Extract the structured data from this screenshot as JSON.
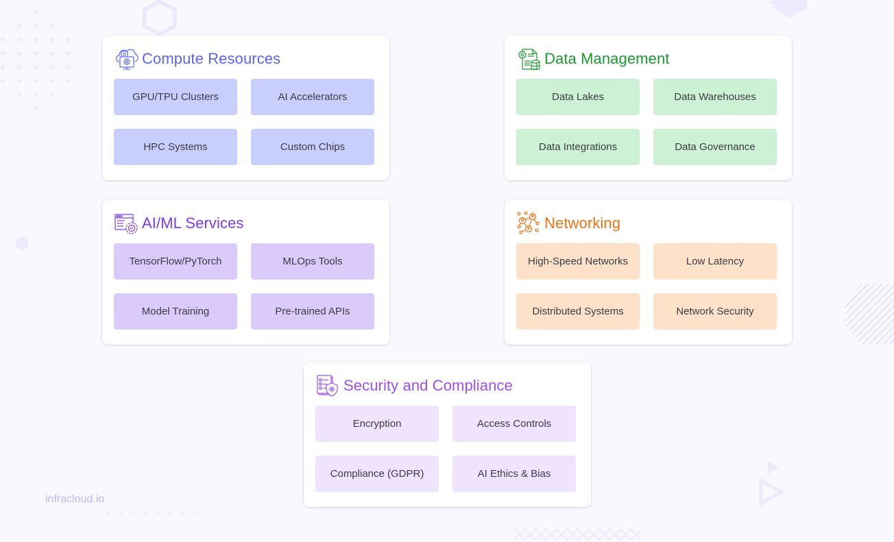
{
  "brand": {
    "text": "infracloud.io"
  },
  "cards": {
    "compute": {
      "title": "Compute Resources",
      "icon": "cloud-computer-gear-icon",
      "title_color": "#5865f2",
      "pill_color": "#c9cffc",
      "items": [
        "GPU/TPU Clusters",
        "AI Accelerators",
        "HPC Systems",
        "Custom Chips"
      ]
    },
    "data": {
      "title": "Data Management",
      "icon": "document-gear-database-icon",
      "title_color": "#1a9a2e",
      "pill_color": "#ccf1d4",
      "items": [
        "Data Lakes",
        "Data Warehouses",
        "Data Integrations",
        "Data Governance"
      ]
    },
    "aiml": {
      "title": "AI/ML Services",
      "icon": "browser-ai-gear-icon",
      "title_color": "#7c3aed",
      "pill_color": "#dacbfb",
      "items": [
        "TensorFlow/PyTorch",
        "MLOps Tools",
        "Model Training",
        "Pre-trained APIs"
      ]
    },
    "net": {
      "title": "Networking",
      "icon": "network-people-icon",
      "title_color": "#ee7211",
      "pill_color": "#fde1c9",
      "items": [
        "High-Speed Networks",
        "Low Latency",
        "Distributed Systems",
        "Network Security"
      ]
    },
    "sec": {
      "title": "Security and Compliance",
      "icon": "checklist-shield-icon",
      "title_color": "#9d4ef0",
      "pill_color": "#efe3fd",
      "items": [
        "Encryption",
        "Access Controls",
        "Compliance (GDPR)",
        "AI Ethics & Bias"
      ]
    }
  }
}
